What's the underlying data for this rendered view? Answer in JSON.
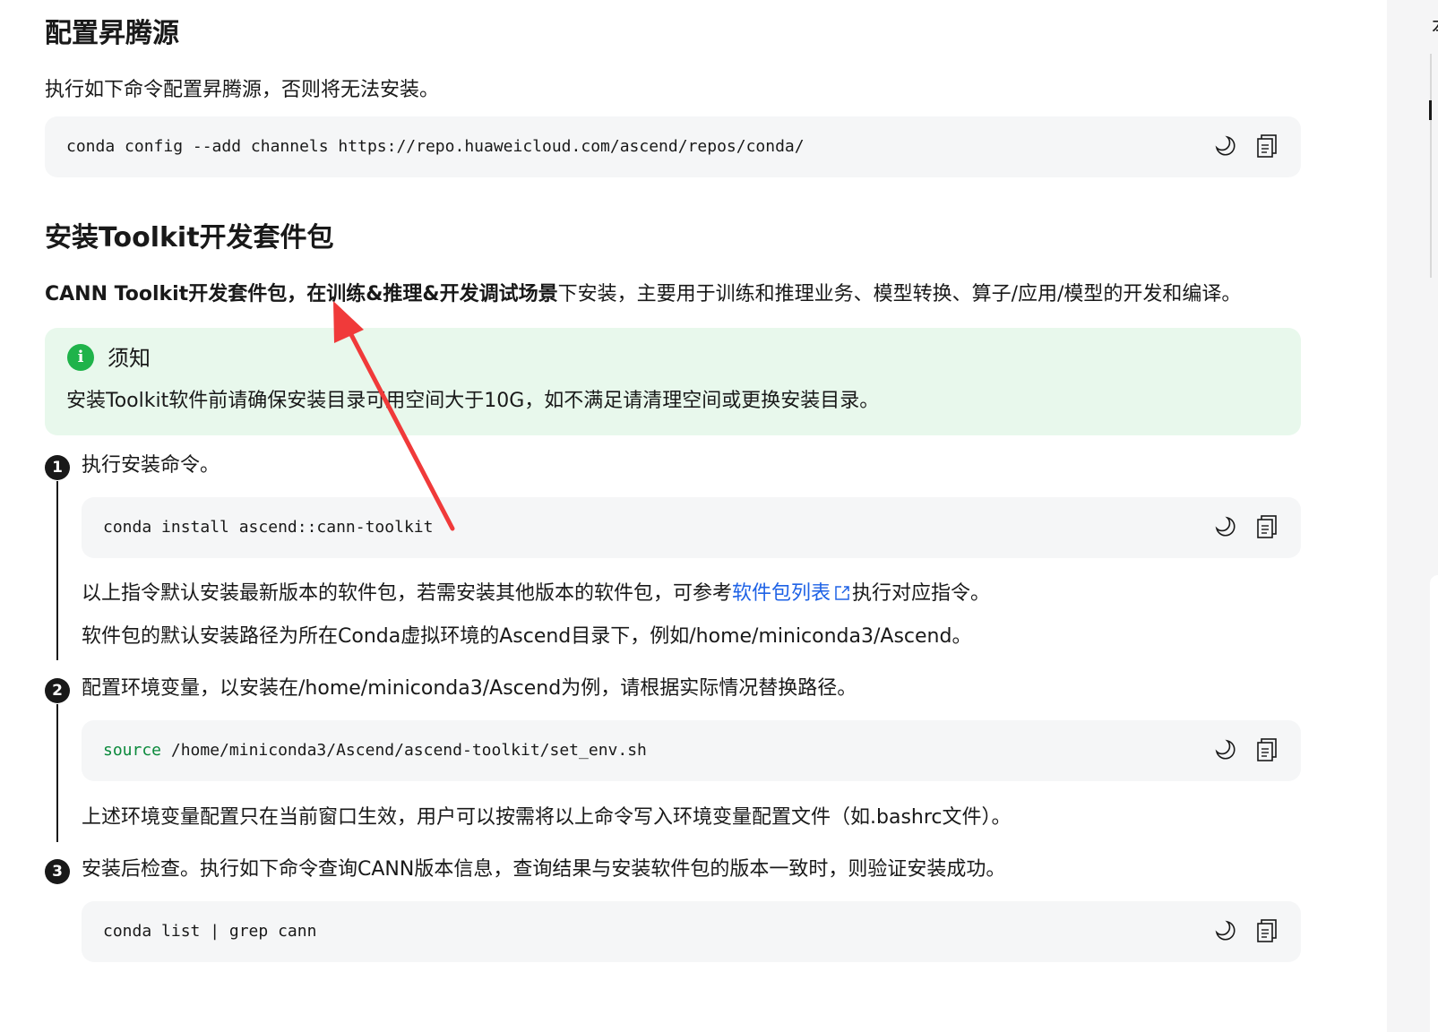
{
  "sections": {
    "repo": {
      "title": "配置昇腾源",
      "desc": "执行如下命令配置昇腾源，否则将无法安装。",
      "code": "conda config --add channels https://repo.huaweicloud.com/ascend/repos/conda/"
    },
    "toolkit": {
      "title": "安装Toolkit开发套件包",
      "intro_bold": "CANN Toolkit开发套件包，在训练&推理&开发调试场景",
      "intro_rest": "下安装，主要用于训练和推理业务、模型转换、算子/应用/模型的开发和编译。",
      "notice_title": "须知",
      "notice_icon": "i",
      "notice_body": "安装Toolkit软件前请确保安装目录可用空间大于10G，如不满足请清理空间或更换安装目录。"
    }
  },
  "steps": [
    {
      "num": "1",
      "text": "执行安装命令。",
      "code": "conda install ascend::cann-toolkit",
      "note1_pre": "以上指令默认安装最新版本的软件包，若需安装其他版本的软件包，可参考",
      "note1_link": "软件包列表",
      "note1_post": "执行对应指令。",
      "note2": "软件包的默认安装路径为所在Conda虚拟环境的Ascend目录下，例如/home/miniconda3/Ascend。"
    },
    {
      "num": "2",
      "text": "配置环境变量，以安装在/home/miniconda3/Ascend为例，请根据实际情况替换路径。",
      "code_kw": "source",
      "code_rest": " /home/miniconda3/Ascend/ascend-toolkit/set_env.sh",
      "note": "上述环境变量配置只在当前窗口生效，用户可以按需将以上命令写入环境变量配置文件（如.bashrc文件）。"
    },
    {
      "num": "3",
      "text": "安装后检查。执行如下命令查询CANN版本信息，查询结果与安装软件包的版本一致时，则验证安装成功。",
      "code": "conda list | grep cann"
    }
  ],
  "right_rail": {
    "label": "本"
  },
  "colors": {
    "accent_link": "#1e62e6",
    "notice_bg": "#e8f8ec",
    "notice_icon": "#1fb34a",
    "arrow": "#f03a3a",
    "code_bg": "#f5f6f7",
    "keyword": "#0b8a3c"
  }
}
